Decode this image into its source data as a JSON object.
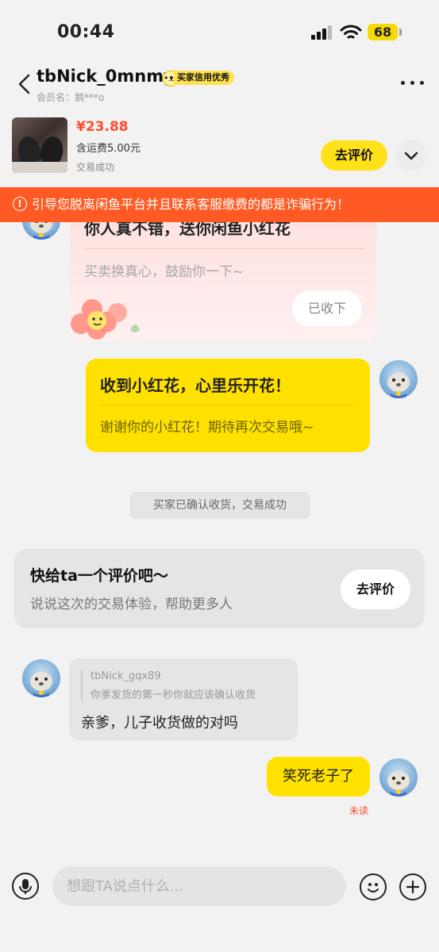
{
  "status_bar": {
    "time": "00:44",
    "battery": "68"
  },
  "header": {
    "nickname": "tbNick_0mnmy",
    "badge": "买家信用优秀",
    "member_label": "会员名：鹅***o"
  },
  "product": {
    "price": "¥23.88",
    "shipping": "含运费5.00元",
    "status": "交易成功",
    "review_button": "去评价"
  },
  "warning": {
    "text": "引导您脱离闲鱼平台并且联系客服缴费的都是诈骗行为！"
  },
  "messages": {
    "flower_card": {
      "title": "你人真不错，送你闲鱼小红花",
      "subtitle": "买卖换真心，鼓励你一下~",
      "button": "已收下"
    },
    "yellow_card": {
      "title": "收到小红花，心里乐开花！",
      "subtitle": "谢谢你的小红花！期待再次交易哦~"
    },
    "system": "买家已确认收货，交易成功",
    "review_card": {
      "title": "快给ta一个评价吧～",
      "subtitle": "说说这次的交易体验，帮助更多人",
      "button": "去评价"
    },
    "quote_message": {
      "quoted_name": "tbNick_gqx89",
      "quoted_text": "你爹发货的第一秒你就应该确认收货",
      "reply": "亲爹，儿子收货做的对吗"
    },
    "my_message": "笑死老子了",
    "read_status": "未读"
  },
  "input": {
    "placeholder": "想跟TA说点什么..."
  },
  "icons": {
    "back": "chevron-left-icon",
    "more": "more-dots-icon",
    "expand": "chevron-down-icon",
    "warning": "alert-circle-icon",
    "voice": "microphone-icon",
    "emoji": "smiley-icon",
    "add": "plus-icon"
  },
  "colors": {
    "accent_yellow": "#ffe100",
    "warning_orange": "#ff5a24",
    "price_red": "#ff4d2e"
  }
}
